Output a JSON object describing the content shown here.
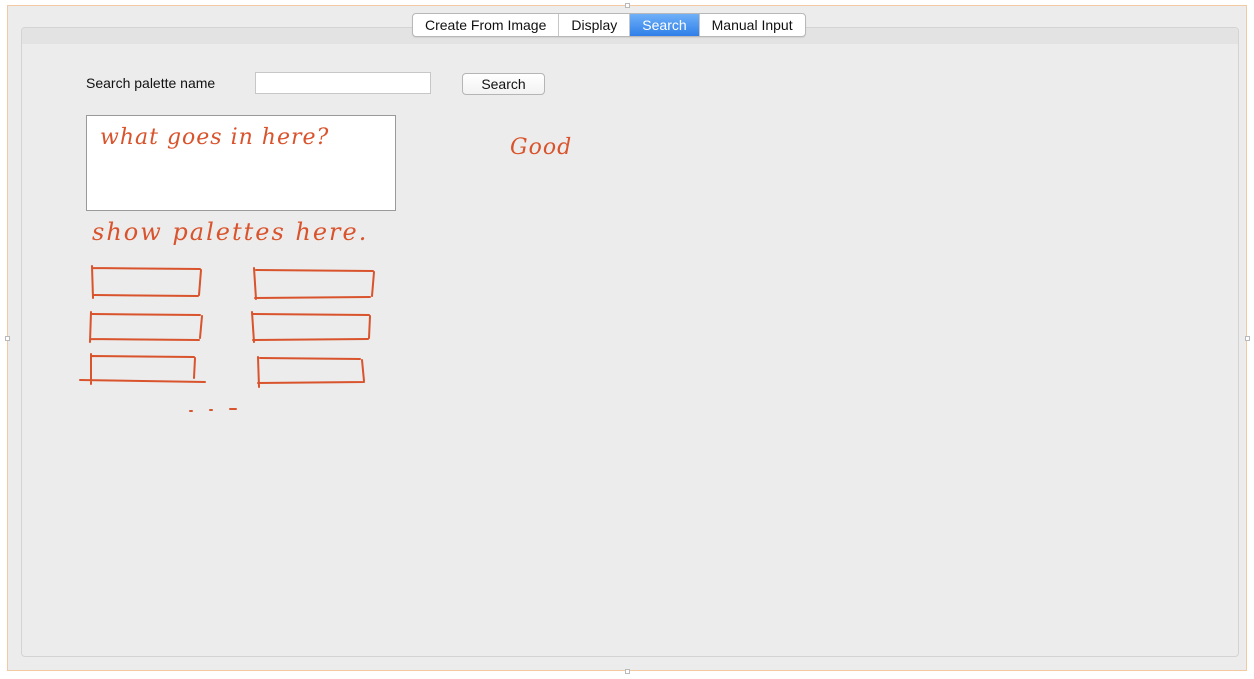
{
  "tabs": [
    {
      "label": "Create From Image",
      "active": false
    },
    {
      "label": "Display",
      "active": false
    },
    {
      "label": "Search",
      "active": true
    },
    {
      "label": "Manual Input",
      "active": false
    }
  ],
  "search": {
    "label": "Search palette name",
    "value": "",
    "placeholder": "",
    "button_label": "Search"
  },
  "annotations": {
    "result_box_note": "what goes in here?",
    "side_note": "Good",
    "palettes_note": "show palettes here."
  },
  "colors": {
    "accent": "#2f7fe9",
    "annotation": "#d9532c",
    "background": "#ececec"
  }
}
